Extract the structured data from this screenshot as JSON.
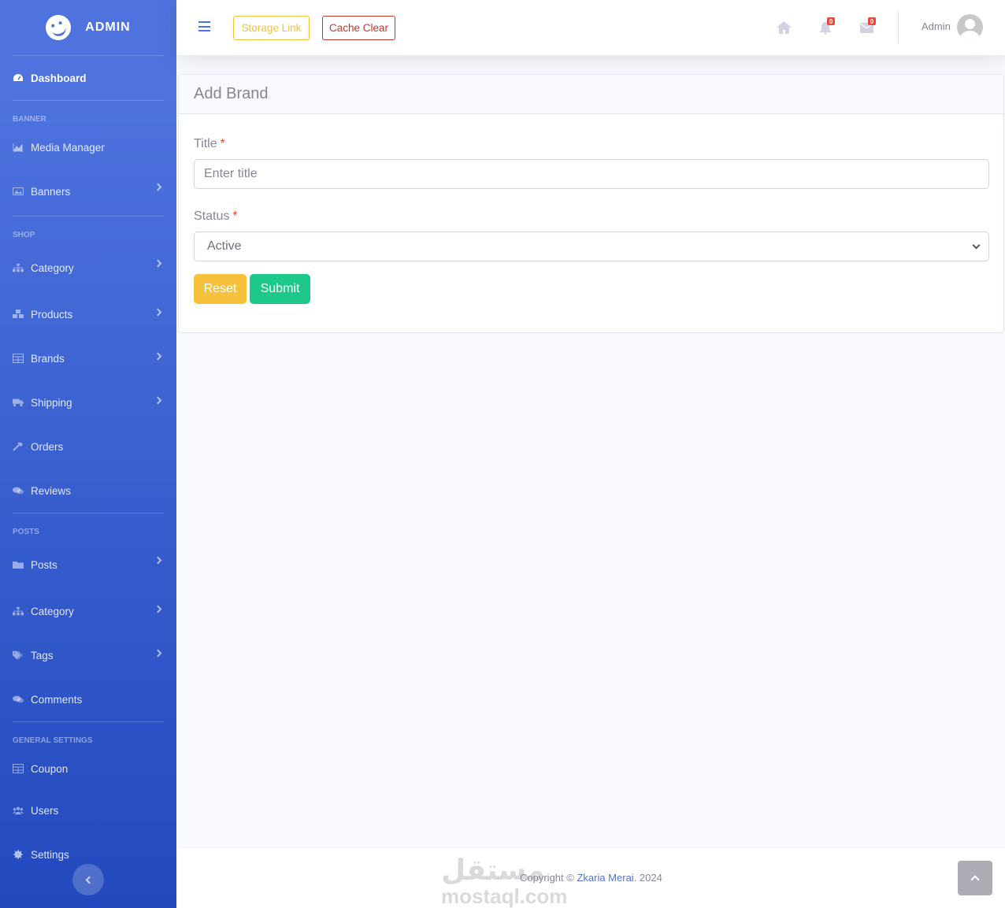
{
  "sidebar": {
    "brand": "ADMIN",
    "dashboard": "Dashboard",
    "headings": {
      "banner": "BANNER",
      "shop": "SHOP",
      "posts": "POSTS",
      "general": "GENERAL SETTINGS"
    },
    "items": {
      "media_manager": "Media Manager",
      "banners": "Banners",
      "shop_category": "Category",
      "products": "Products",
      "brands": "Brands",
      "shipping": "Shipping",
      "orders": "Orders",
      "reviews": "Reviews",
      "posts": "Posts",
      "post_category": "Category",
      "tags": "Tags",
      "comments": "Comments",
      "coupon": "Coupon",
      "users": "Users",
      "settings": "Settings"
    }
  },
  "topbar": {
    "storage_link": "Storage Link",
    "cache_clear": "Cache Clear",
    "notifications_count": "0",
    "messages_count": "0",
    "user_name": "Admin"
  },
  "form": {
    "title": "Add Brand",
    "title_label": "Title",
    "required_mark": "*",
    "title_placeholder": "Enter title",
    "status_label": "Status",
    "status_value": "Active",
    "reset": "Reset",
    "submit": "Submit"
  },
  "footer": {
    "copyright_prefix": "Copyright ©",
    "author": "Zkaria Merai",
    "year": ". 2024",
    "watermark_ar": "مستقل",
    "watermark_en": "mostaql.com"
  },
  "colors": {
    "primary": "#4e73df",
    "warning": "#f6c23e",
    "success": "#1cc88a",
    "danger": "#e74a3b"
  }
}
